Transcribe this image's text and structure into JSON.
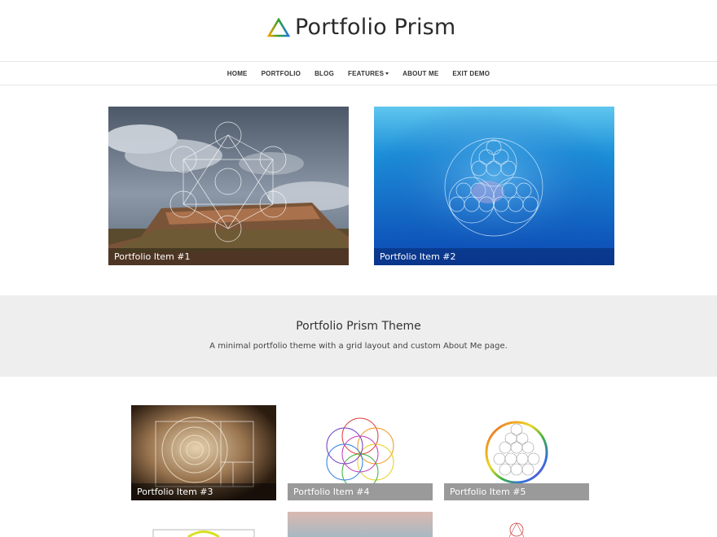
{
  "site": {
    "title": "Portfolio Prism"
  },
  "nav": {
    "items": [
      {
        "label": "Home"
      },
      {
        "label": "Portfolio"
      },
      {
        "label": "Blog"
      },
      {
        "label": "Features"
      },
      {
        "label": "About Me"
      },
      {
        "label": "Exit Demo"
      }
    ]
  },
  "featured": [
    {
      "caption": "Portfolio Item #1"
    },
    {
      "caption": "Portfolio Item #2"
    }
  ],
  "band": {
    "title": "Portfolio Prism Theme",
    "subtitle": "A minimal portfolio theme with a grid layout and custom About Me page."
  },
  "grid": [
    {
      "caption": "Portfolio Item #3"
    },
    {
      "caption": "Portfolio Item #4"
    },
    {
      "caption": "Portfolio Item #5"
    }
  ],
  "icons": {
    "logo": "prism-triangle-icon",
    "dropdown": "caret-down-icon"
  },
  "colors": {
    "band_bg": "#eeeeee",
    "caption_gray": "#9a9a9a",
    "text": "#333333"
  }
}
